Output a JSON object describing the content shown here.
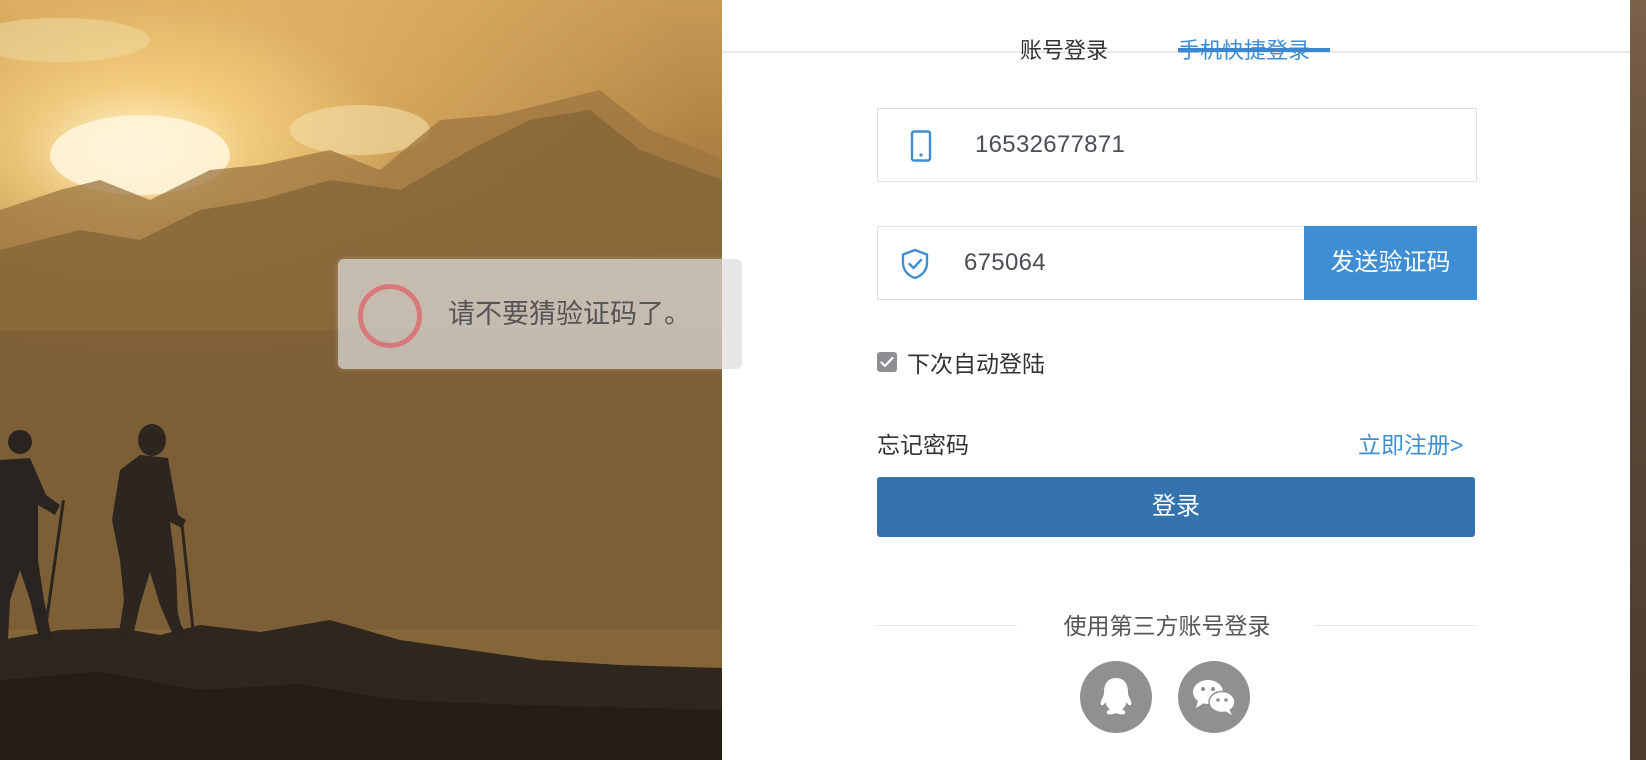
{
  "tabs": {
    "account_login": "账号登录",
    "phone_login": "手机快捷登录",
    "active": "phone_login"
  },
  "phone_field": {
    "icon": "mobile-phone-icon",
    "value": "16532677871"
  },
  "code_field": {
    "icon": "shield-check-icon",
    "value": "675064",
    "send_button": "发送验证码"
  },
  "remember": {
    "checked": true,
    "label": "下次自动登陆"
  },
  "links": {
    "forgot_password": "忘记密码",
    "register": "立即注册>"
  },
  "login_button": "登录",
  "third_party": {
    "label": "使用第三方账号登录",
    "providers": [
      {
        "icon": "qq-icon"
      },
      {
        "icon": "wechat-icon"
      }
    ]
  },
  "toast": {
    "message": "请不要猜验证码了。"
  },
  "colors": {
    "accent": "#3f8ed3",
    "login_button": "#3473ad",
    "toast_ring": "#d9787a"
  }
}
